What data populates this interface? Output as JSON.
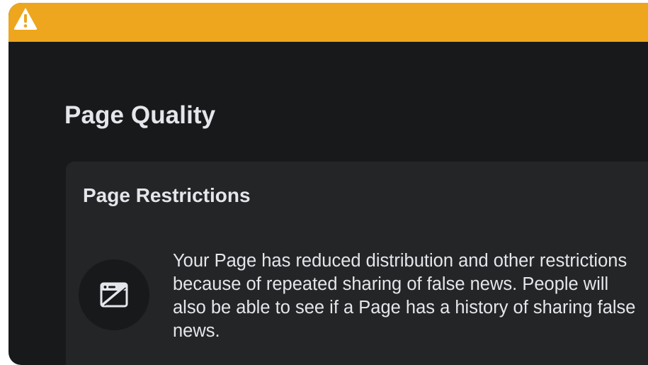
{
  "banner": {
    "icon": "warning-triangle-icon",
    "color": "#eda61d"
  },
  "page_title": "Page Quality",
  "restrictions_card": {
    "title": "Page Restrictions",
    "icon": "restricted-page-icon",
    "text": "Your Page has reduced distribution and other restrictions because of repeated sharing of false news. People will also be able to see if a Page has a history of sharing false news."
  },
  "colors": {
    "background": "#18191a",
    "card": "#242526",
    "text": "#e4e6eb"
  }
}
